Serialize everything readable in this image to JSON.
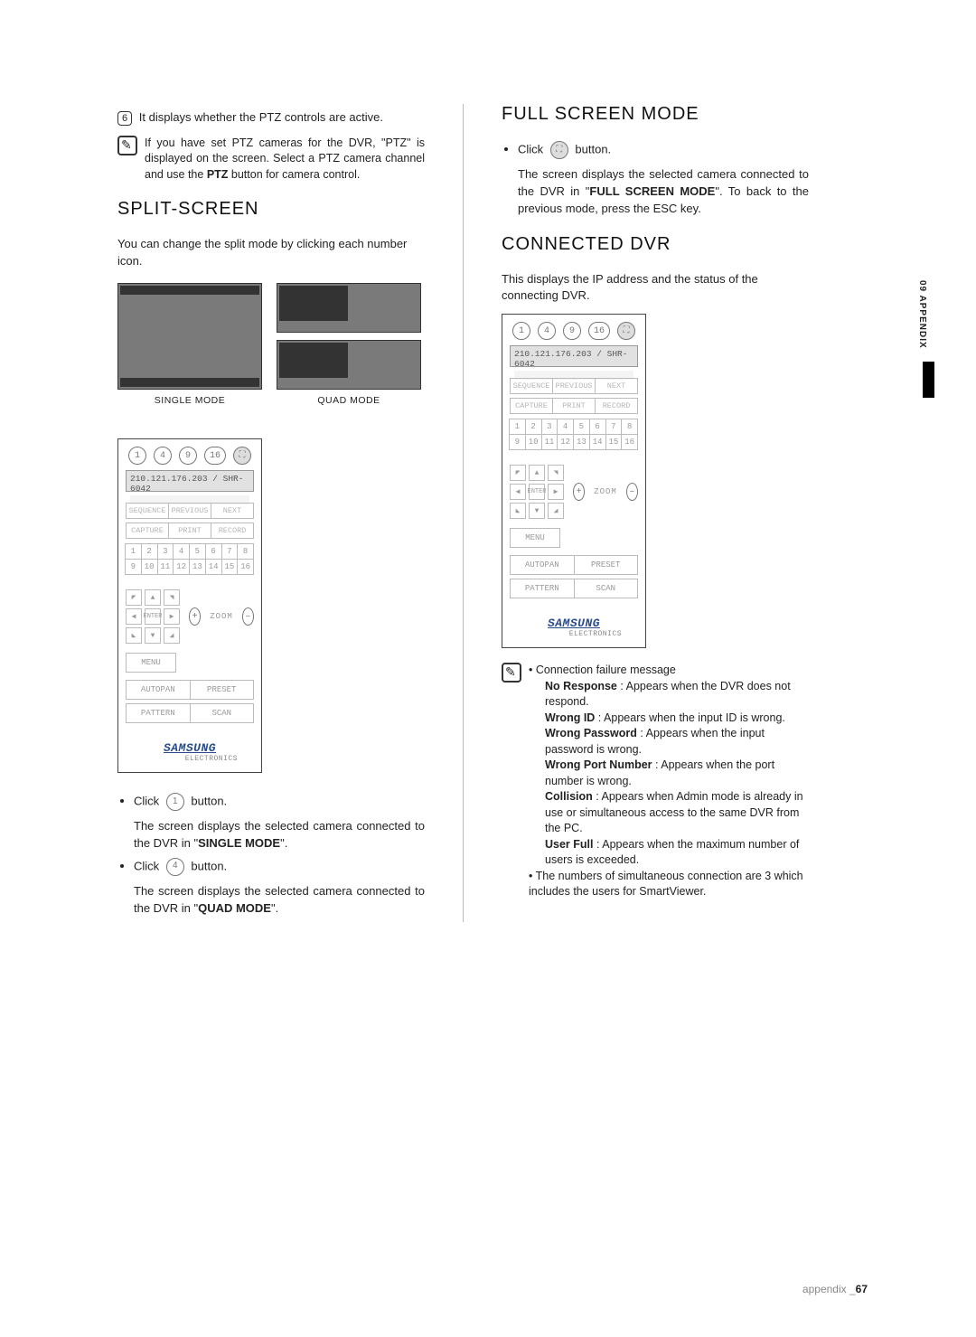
{
  "sideTab": "09 APPENDIX",
  "footer": {
    "label": "appendix _",
    "number": "67"
  },
  "left": {
    "item6_marker": "6",
    "item6_text": "It displays whether the PTZ controls are active.",
    "note_ptz": "If you have set PTZ cameras for the DVR, \"PTZ\" is displayed on the screen. Select a PTZ camera channel and use the PTZ button for camera control.",
    "ptz_bold": "PTZ",
    "heading_split": "SPLIT-SCREEN",
    "split_intro": "You can change the split mode by clicking each number icon.",
    "cap_single": "SINGLE MODE",
    "cap_quad": "QUAD MODE",
    "click1_pre": "Click ",
    "click1_post": " button.",
    "click1_icon": "1",
    "click1_desc_pre": "The screen displays the selected camera connected to the DVR in \"",
    "click1_mode": "SINGLE MODE",
    "click1_desc_post": "\".",
    "click4_pre": "Click ",
    "click4_post": " button.",
    "click4_icon": "4",
    "click4_desc_pre": "The screen displays the selected camera connected to the DVR in \"",
    "click4_mode": "QUAD MODE",
    "click4_desc_post": "\"."
  },
  "right": {
    "heading_full": "FULL SCREEN MODE",
    "clickF_pre": "Click ",
    "clickF_post": " button.",
    "full_desc_pre": "The screen displays the selected camera connected to the DVR in \"",
    "full_mode": "FULL SCREEN MODE",
    "full_desc_post": "\". To back to the previous mode, press the ESC key.",
    "heading_conn": "CONNECTED DVR",
    "conn_intro": "This displays the IP address and the status of the connecting DVR.",
    "conn_fail_head": "Connection failure message",
    "errs": {
      "noresp_b": "No Response",
      "noresp_t": " : Appears when the DVR does not respond.",
      "wid_b": "Wrong ID",
      "wid_t": " : Appears when the input ID is wrong.",
      "wpw_b": "Wrong Password",
      "wpw_t": " : Appears when the input password is wrong.",
      "wport_b": "Wrong Port Number",
      "wport_t": " : Appears when the port number is wrong.",
      "col_b": "Collision",
      "col_t": " : Appears when Admin mode is already in use or simultaneous access to the same DVR from the PC.",
      "uf_b": "User Full",
      "uf_t": " : Appears when the maximum number of users is exceeded."
    },
    "simul": "The numbers of simultaneous connection are 3 which includes the users for SmartViewer."
  },
  "panel": {
    "ipline": "210.121.176.203 / SHR-6042",
    "top_icons": [
      "1",
      "4",
      "9",
      "16"
    ],
    "row_a": [
      "SEQUENCE",
      "PREVIOUS",
      "NEXT"
    ],
    "row_b": [
      "CAPTURE",
      "PRINT",
      "RECORD"
    ],
    "nums": [
      "1",
      "2",
      "3",
      "4",
      "5",
      "6",
      "7",
      "8",
      "9",
      "10",
      "11",
      "12",
      "13",
      "14",
      "15",
      "16"
    ],
    "dpad": [
      "◤",
      "▲",
      "◥",
      "◀",
      "ENTER",
      "▶",
      "◣",
      "▼",
      "◢"
    ],
    "zoom": "ZOOM",
    "plus": "+",
    "minus": "–",
    "menu": "MENU",
    "autopan": "AUTOPAN",
    "preset": "PRESET",
    "pattern": "PATTERN",
    "scan": "SCAN",
    "brand_s": "SAMSUNG",
    "brand_e": "ELECTRONICS"
  }
}
